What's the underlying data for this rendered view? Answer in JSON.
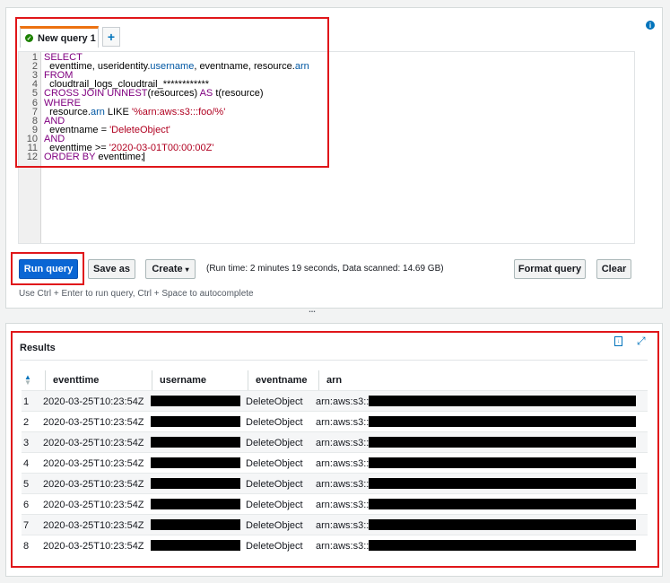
{
  "editor": {
    "tab_label": "New query 1",
    "add_tab_label": "+",
    "info_icon": "info-icon",
    "lines": [
      [
        {
          "t": "SELECT",
          "c": "kw"
        }
      ],
      [
        {
          "t": "  eventtime, useridentity.",
          "c": ""
        },
        {
          "t": "username",
          "c": "prop"
        },
        {
          "t": ", eventname, resource.",
          "c": ""
        },
        {
          "t": "arn",
          "c": "prop"
        }
      ],
      [
        {
          "t": "FROM",
          "c": "kw"
        }
      ],
      [
        {
          "t": "  cloudtrail_logs_cloudtrail_************",
          "c": ""
        }
      ],
      [
        {
          "t": "CROSS JOIN UNNEST",
          "c": "kw"
        },
        {
          "t": "(resources) ",
          "c": ""
        },
        {
          "t": "AS",
          "c": "kw"
        },
        {
          "t": " t(resource)",
          "c": ""
        }
      ],
      [
        {
          "t": "WHERE",
          "c": "kw"
        }
      ],
      [
        {
          "t": "  resource.",
          "c": ""
        },
        {
          "t": "arn",
          "c": "prop"
        },
        {
          "t": " LIKE ",
          "c": ""
        },
        {
          "t": "'%arn:aws:s3:::foo/%'",
          "c": "str"
        }
      ],
      [
        {
          "t": "AND",
          "c": "kw"
        }
      ],
      [
        {
          "t": "  eventname = ",
          "c": ""
        },
        {
          "t": "'DeleteObject'",
          "c": "str"
        }
      ],
      [
        {
          "t": "AND",
          "c": "kw"
        }
      ],
      [
        {
          "t": "  eventtime >= ",
          "c": ""
        },
        {
          "t": "'2020-03-01T00:00:00Z'",
          "c": "str"
        }
      ],
      [
        {
          "t": "ORDER BY",
          "c": "kw"
        },
        {
          "t": " eventtime;",
          "c": ""
        }
      ]
    ],
    "line_numbers": [
      "1",
      "2",
      "3",
      "4",
      "5",
      "6",
      "7",
      "8",
      "9",
      "10",
      "11",
      "12"
    ]
  },
  "toolbar": {
    "run_label": "Run query",
    "save_label": "Save as",
    "create_label": "Create",
    "run_info": "(Run time: 2 minutes 19 seconds, Data scanned: 14.69 GB)",
    "format_label": "Format query",
    "clear_label": "Clear",
    "hint": "Use Ctrl + Enter to run query, Ctrl + Space to autocomplete"
  },
  "splitter": "...",
  "results": {
    "title": "Results",
    "columns": [
      "eventtime",
      "username",
      "eventname",
      "arn"
    ],
    "rows": [
      {
        "n": "1",
        "eventtime": "2020-03-25T10:23:54Z",
        "eventname": "DeleteObject",
        "arn": "arn:aws:s3:::"
      },
      {
        "n": "2",
        "eventtime": "2020-03-25T10:23:54Z",
        "eventname": "DeleteObject",
        "arn": "arn:aws:s3:::"
      },
      {
        "n": "3",
        "eventtime": "2020-03-25T10:23:54Z",
        "eventname": "DeleteObject",
        "arn": "arn:aws:s3:::"
      },
      {
        "n": "4",
        "eventtime": "2020-03-25T10:23:54Z",
        "eventname": "DeleteObject",
        "arn": "arn:aws:s3:::"
      },
      {
        "n": "5",
        "eventtime": "2020-03-25T10:23:54Z",
        "eventname": "DeleteObject",
        "arn": "arn:aws:s3:::"
      },
      {
        "n": "6",
        "eventtime": "2020-03-25T10:23:54Z",
        "eventname": "DeleteObject",
        "arn": "arn:aws:s3:::"
      },
      {
        "n": "7",
        "eventtime": "2020-03-25T10:23:54Z",
        "eventname": "DeleteObject",
        "arn": "arn:aws:s3:::"
      },
      {
        "n": "8",
        "eventtime": "2020-03-25T10:23:54Z",
        "eventname": "DeleteObject",
        "arn": "arn:aws:s3:::"
      }
    ]
  },
  "colors": {
    "accent": "#0a66d4",
    "tab_accent": "#ec7211",
    "highlight": "#e0161a",
    "success": "#1d8102"
  }
}
